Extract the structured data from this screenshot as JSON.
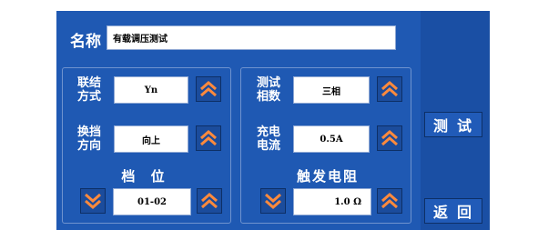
{
  "header": {
    "name_label": "名称",
    "name_value": "有载调压测试"
  },
  "left_group": {
    "connection_label": "联结\n方式",
    "connection_value": "Yn",
    "direction_label": "换挡\n方向",
    "direction_value": "向上",
    "tap_caption": "档 位",
    "tap_value": "01-02"
  },
  "right_group": {
    "phase_label": "测试\n相数",
    "phase_value": "三相",
    "current_label": "充电\n电流",
    "current_value": "0.5A",
    "trigger_caption": "触发电阻",
    "trigger_value": "1.0 Ω"
  },
  "side": {
    "test_label": "测试",
    "back_label": "返回"
  },
  "icons": {
    "up": "chevron-up-icon",
    "down": "chevron-down-icon"
  },
  "colors": {
    "panel": "#1f59b3",
    "arrow": "#ff8a3c"
  }
}
